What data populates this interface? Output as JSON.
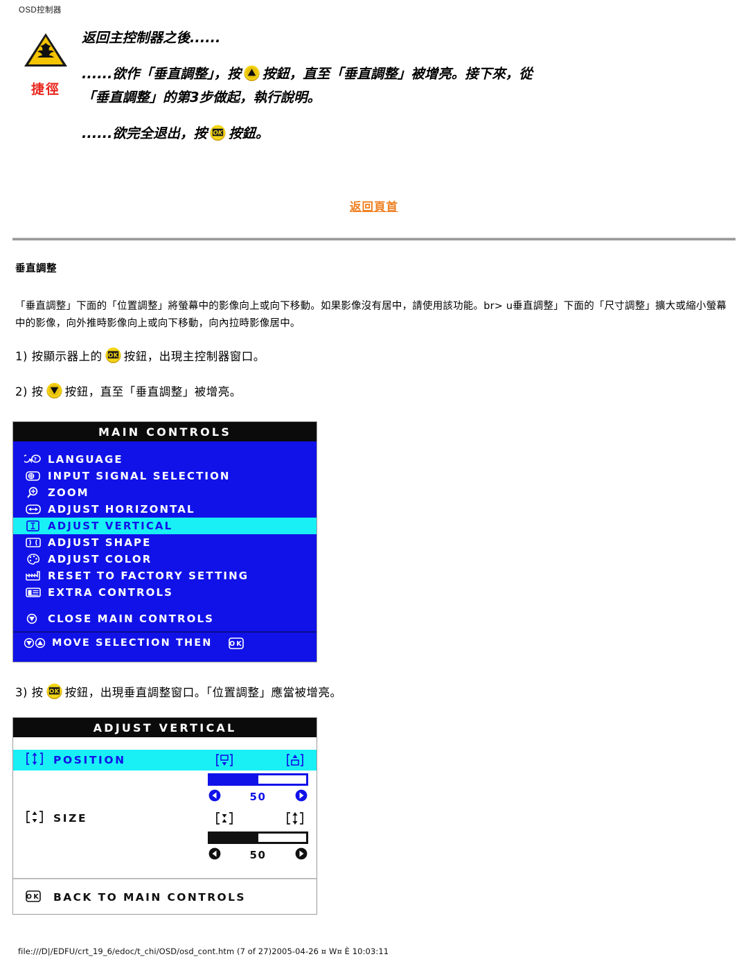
{
  "document": {
    "title": "OSD控制器",
    "footer_path": "file:///D|/EDFU/crt_19_6/edoc/t_chi/OSD/osd_cont.htm (7 of 27)2005-04-26 ¤ W¤ È  10:03:11"
  },
  "tip": {
    "warning_icon": "warning-triangle-icon",
    "shortcut_label": "捷徑",
    "line1": "返回主控制器之後......",
    "line2_a": "......欲作「垂直調整」，按",
    "line2_icon": "up-button-icon",
    "line2_b": "按鈕，直至「垂直調整」被增亮。接下來，從",
    "line3": "「垂直調整」的第3步做起，執行說明。",
    "line4_a": "......欲完全退出，按",
    "line4_icon": "ok-button-icon",
    "line4_b": "按鈕。"
  },
  "back_to_top": {
    "label": "返回頁首"
  },
  "section": {
    "heading": "垂直調整",
    "paragraph": "「垂直調整」下面的「位置調整」將螢幕中的影像向上或向下移動。如果影像沒有居中，請使用該功能。br> u垂直調整」下面的「尺寸調整」擴大或縮小螢幕中的影像，向外推時影像向上或向下移動，向內拉時影像居中。"
  },
  "steps": {
    "step1_a": "1) 按顯示器上的",
    "step1_icon": "ok-button-icon",
    "step1_b": "按鈕，出現主控制器窗口。",
    "step2_a": "2) 按",
    "step2_icon": "down-button-icon",
    "step2_b": "按鈕，直至「垂直調整」被增亮。",
    "step3_a": "3) 按",
    "step3_icon": "ok-button-icon",
    "step3_b": "按鈕，出現垂直調整窗口。「位置調整」應當被增亮。"
  },
  "osd_main": {
    "title": "MAIN CONTROLS",
    "items": [
      {
        "label": "LANGUAGE",
        "icon": "language-icon",
        "selected": false
      },
      {
        "label": "INPUT SIGNAL SELECTION",
        "icon": "input-signal-icon",
        "selected": false
      },
      {
        "label": "ZOOM",
        "icon": "zoom-magnifier-icon",
        "selected": false
      },
      {
        "label": "ADJUST HORIZONTAL",
        "icon": "adjust-horizontal-icon",
        "selected": false
      },
      {
        "label": "ADJUST VERTICAL",
        "icon": "adjust-vertical-icon",
        "selected": true
      },
      {
        "label": "ADJUST SHAPE",
        "icon": "adjust-shape-icon",
        "selected": false
      },
      {
        "label": "ADJUST COLOR",
        "icon": "adjust-color-palette-icon",
        "selected": false
      },
      {
        "label": "RESET TO FACTORY SETTING",
        "icon": "factory-reset-icon",
        "selected": false
      },
      {
        "label": "EXTRA CONTROLS",
        "icon": "extra-controls-icon",
        "selected": false
      }
    ],
    "close_item": {
      "label": "CLOSE MAIN CONTROLS",
      "icon": "close-down-arrow-icon"
    },
    "footer": {
      "label": "MOVE SELECTION THEN",
      "icons": "down-up-arrow-icons",
      "ok_icon": "ok-icon"
    },
    "colors": {
      "background": "#1112e8",
      "titlebar": "#0b0b0b",
      "highlight": "#19f0f5",
      "text": "#ffffff",
      "highlight_text": "#1112e8"
    }
  },
  "osd_vertical": {
    "title": "ADJUST VERTICAL",
    "rows": [
      {
        "label": "POSITION",
        "icon": "position-vertical-icon",
        "selected": true,
        "marker1": "move-down-icon",
        "marker2": "move-up-icon",
        "value": "50",
        "percent": 50,
        "left_arrow": "left-arrow-icon",
        "right_arrow": "right-arrow-icon"
      },
      {
        "label": "SIZE",
        "icon": "size-vertical-icon",
        "selected": false,
        "marker1": "shrink-vertical-icon",
        "marker2": "expand-vertical-icon",
        "value": "50",
        "percent": 50,
        "left_arrow": "left-arrow-icon",
        "right_arrow": "right-arrow-icon"
      }
    ],
    "footer": {
      "label": "BACK TO MAIN CONTROLS",
      "icon": "ok-icon"
    },
    "colors": {
      "background": "#ffffff",
      "titlebar": "#0b0b0b",
      "highlight": "#19f0f5",
      "accent": "#1112e8"
    }
  }
}
